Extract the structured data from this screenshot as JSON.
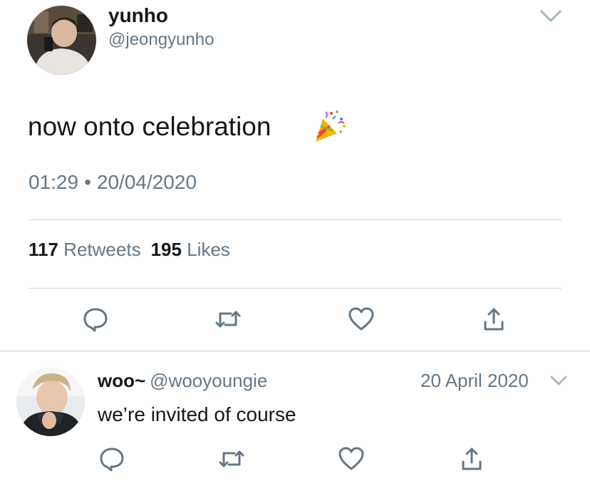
{
  "main_tweet": {
    "display_name": "yunho",
    "handle": "@jeongyunho",
    "text": "now onto celebration",
    "emoji_icon": "party-popper-icon",
    "time": "01:29",
    "separator": "•",
    "date": "20/04/2020",
    "retweets_count": "117",
    "retweets_label": "Retweets",
    "likes_count": "195",
    "likes_label": "Likes",
    "actions": [
      "reply-icon",
      "retweet-icon",
      "like-icon",
      "share-icon"
    ]
  },
  "reply_tweet": {
    "display_name": "woo~",
    "handle": "@wooyoungie",
    "date": "20 April 2020",
    "text": "we’re invited of course",
    "actions": [
      "reply-icon",
      "retweet-icon",
      "like-icon",
      "share-icon"
    ]
  },
  "colors": {
    "text_primary": "#14171a",
    "text_secondary": "#657786",
    "icon_gray": "#657786",
    "divider": "#ccd6dd"
  }
}
